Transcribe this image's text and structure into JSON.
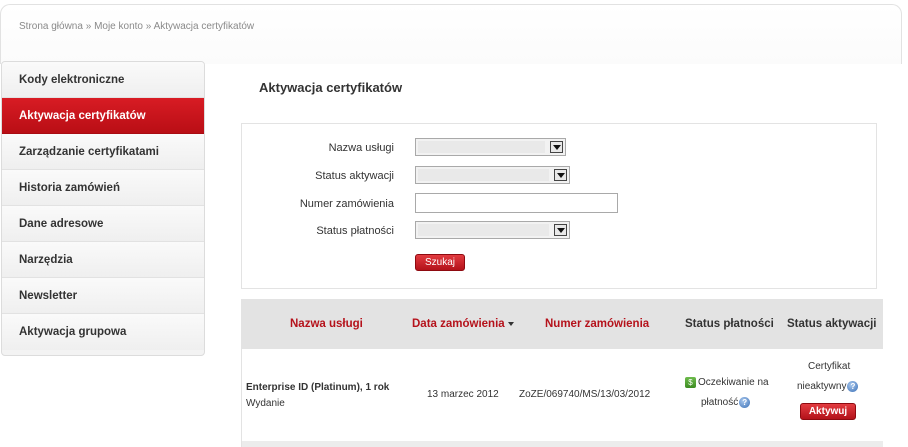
{
  "breadcrumb": {
    "home": "Strona główna",
    "account": "Moje konto",
    "current": "Aktywacja certyfikatów",
    "separator": "»"
  },
  "sidebar": {
    "items": [
      {
        "label": "Kody elektroniczne",
        "active": false
      },
      {
        "label": "Aktywacja certyfikatów",
        "active": true
      },
      {
        "label": "Zarządzanie certyfikatami",
        "active": false
      },
      {
        "label": "Historia zamówień",
        "active": false
      },
      {
        "label": "Dane adresowe",
        "active": false
      },
      {
        "label": "Narzędzia",
        "active": false
      },
      {
        "label": "Newsletter",
        "active": false
      },
      {
        "label": "Aktywacja grupowa",
        "active": false
      }
    ]
  },
  "page": {
    "title": "Aktywacja certyfikatów"
  },
  "search_form": {
    "service_label": "Nazwa usługi",
    "service_value": "",
    "activation_status_label": "Status aktywacji",
    "activation_status_value": "",
    "order_number_label": "Numer zamówienia",
    "order_number_value": "",
    "payment_status_label": "Status płatności",
    "payment_status_value": "",
    "search_button": "Szukaj"
  },
  "table": {
    "headers": {
      "service": "Nazwa usługi",
      "order_date": "Data zamówienia",
      "order_number": "Numer zamówienia",
      "payment_status": "Status płatności",
      "activation_status": "Status aktywacji"
    },
    "rows": [
      {
        "service": "Enterprise ID (Platinum), 1 rok",
        "service_type": "Wydanie",
        "order_date": "13 marzec 2012",
        "order_number": "ZoZE/069740/MS/13/03/2012",
        "payment_line1": "Oczekiwanie na",
        "payment_line2": "płatność",
        "activation_line1": "Certyfikat",
        "activation_line2": "nieaktywny",
        "activate_button": "Aktywuj"
      }
    ]
  },
  "icons": {
    "help": "?",
    "payment": "$"
  },
  "colors": {
    "accent": "#c8141c",
    "header_bg": "#e3e3e3",
    "sidebar_bg": "#f3f3f3"
  }
}
